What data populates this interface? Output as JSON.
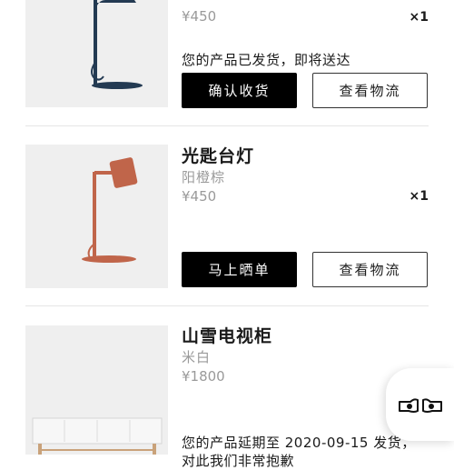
{
  "orders": [
    {
      "title": "",
      "variant": "",
      "price": "¥450",
      "quantity": "×1",
      "status": "您的产品已发货，即将送达",
      "primary_action": "确认收货",
      "secondary_action": "查看物流",
      "image_icon": "desk-lamp-navy"
    },
    {
      "title": "光匙台灯",
      "variant": "阳橙棕",
      "price": "¥450",
      "quantity": "×1",
      "primary_action": "马上晒单",
      "secondary_action": "查看物流",
      "image_icon": "desk-lamp-orange"
    },
    {
      "title": "山雪电视柜",
      "variant": "米白",
      "price": "¥1800",
      "status": "您的产品延期至 2020-09-15 发货，",
      "status_line2": "对此我们非常抱歉",
      "image_icon": "tv-cabinet-white"
    }
  ],
  "floating_button": {
    "icon": "pointing-hands-icon"
  },
  "colors": {
    "primary": "#000000",
    "thumb_bg": "#efefef",
    "lamp_navy": "#233a52",
    "lamp_orange": "#c0654a",
    "muted_text": "#9a9a9a"
  }
}
